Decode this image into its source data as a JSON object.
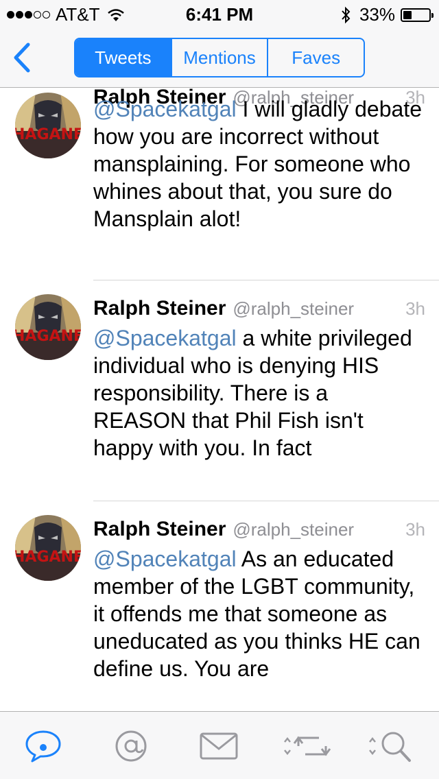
{
  "status_bar": {
    "carrier": "AT&T",
    "time": "6:41 PM",
    "battery_text": "33%",
    "battery_level": 0.33
  },
  "nav": {
    "segments": [
      "Tweets",
      "Mentions",
      "Faves"
    ],
    "active_segment": "Tweets"
  },
  "tweets": [
    {
      "name": "Ralph Steiner",
      "handle": "@ralph_steiner",
      "time": "3h",
      "mention": "@Spacekatgal",
      "text": " I will gladly debate how you are incorrect without mansplaining. For someone who whines about that, you sure do Mansplain alot!"
    },
    {
      "name": "Ralph Steiner",
      "handle": "@ralph_steiner",
      "time": "3h",
      "mention": "@Spacekatgal",
      "text": " a white privileged individual who is denying HIS responsibility. There is a REASON that Phil Fish isn't happy with you. In fact"
    },
    {
      "name": "Ralph Steiner",
      "handle": "@ralph_steiner",
      "time": "3h",
      "mention": "@Spacekatgal",
      "text": " As an educated member of the LGBT community, it offends me that someone as uneducated as you thinks HE can define us. You are"
    }
  ],
  "avatar_text": "HAGANE",
  "tab_bar": {
    "icons": [
      "speech-bubble-icon",
      "at-sign-icon",
      "envelope-icon",
      "retweet-icon",
      "search-icon"
    ],
    "active": "speech-bubble-icon"
  },
  "colors": {
    "accent": "#1a82fb",
    "mention": "#5183b8",
    "bar_background": "#f7f7f8",
    "timestamp": "#b4b4b8"
  }
}
